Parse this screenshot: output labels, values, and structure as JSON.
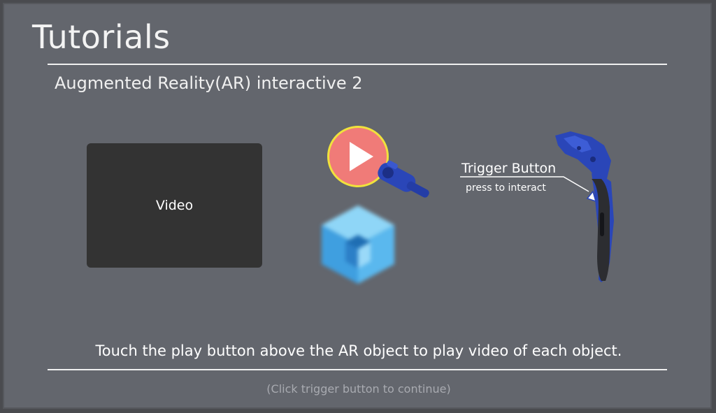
{
  "header": {
    "title": "Tutorials",
    "subtitle": "Augmented Reality(AR) interactive 2"
  },
  "video": {
    "label": "Video"
  },
  "controller": {
    "trigger_title": "Trigger Button",
    "trigger_subtitle": "press to interact"
  },
  "footer": {
    "instruction": "Touch the play button above the AR object to play video of each object.",
    "continue_hint": "(Click trigger button to continue)"
  },
  "colors": {
    "panel": "#63666d",
    "video_bg": "#333333",
    "play_fill": "#f07b78",
    "play_ring": "#f0e23c",
    "controller_blue": "#2a46b8",
    "cube_blue": "#5ab8ee"
  },
  "icons": {
    "play": "play-icon",
    "controller": "vr-controller-icon",
    "cube": "ar-cube-icon"
  }
}
